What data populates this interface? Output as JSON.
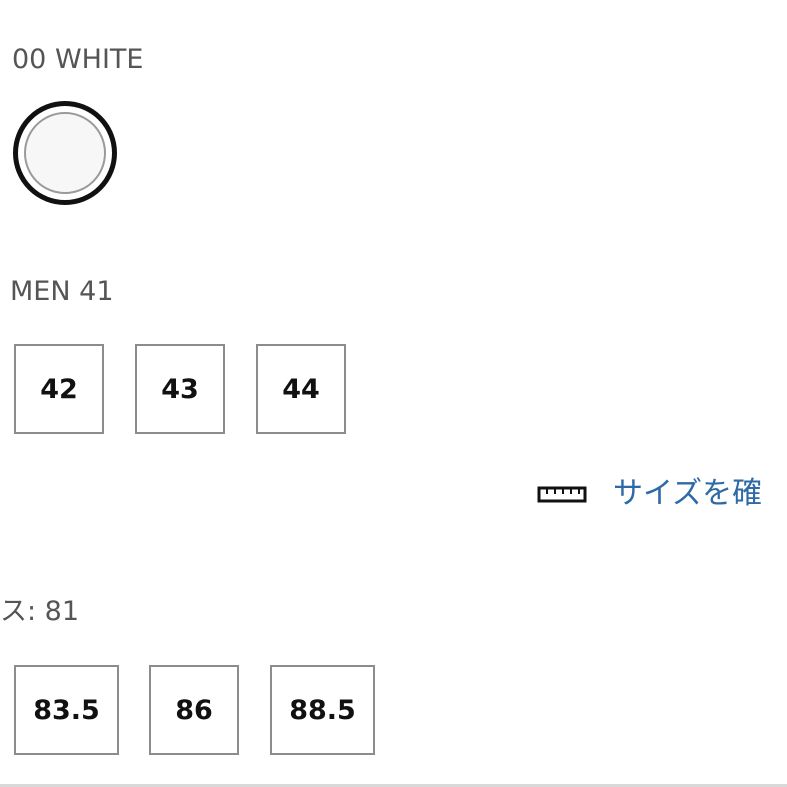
{
  "color": {
    "label": "00 WHITE",
    "swatch_name": "white-swatch",
    "swatch_fill": "#f7f7f7"
  },
  "shoe_size": {
    "label": "MEN 41",
    "options": [
      "42",
      "43",
      "44"
    ]
  },
  "size_guide": {
    "icon": "ruler-icon",
    "text": "サイズを確"
  },
  "waist_size": {
    "label": "ス: 81",
    "options": [
      "83.5",
      "86",
      "88.5"
    ]
  },
  "colors": {
    "link": "#2d6aa6",
    "box_border": "#8c8c8c",
    "swatch_ring": "#111111"
  }
}
